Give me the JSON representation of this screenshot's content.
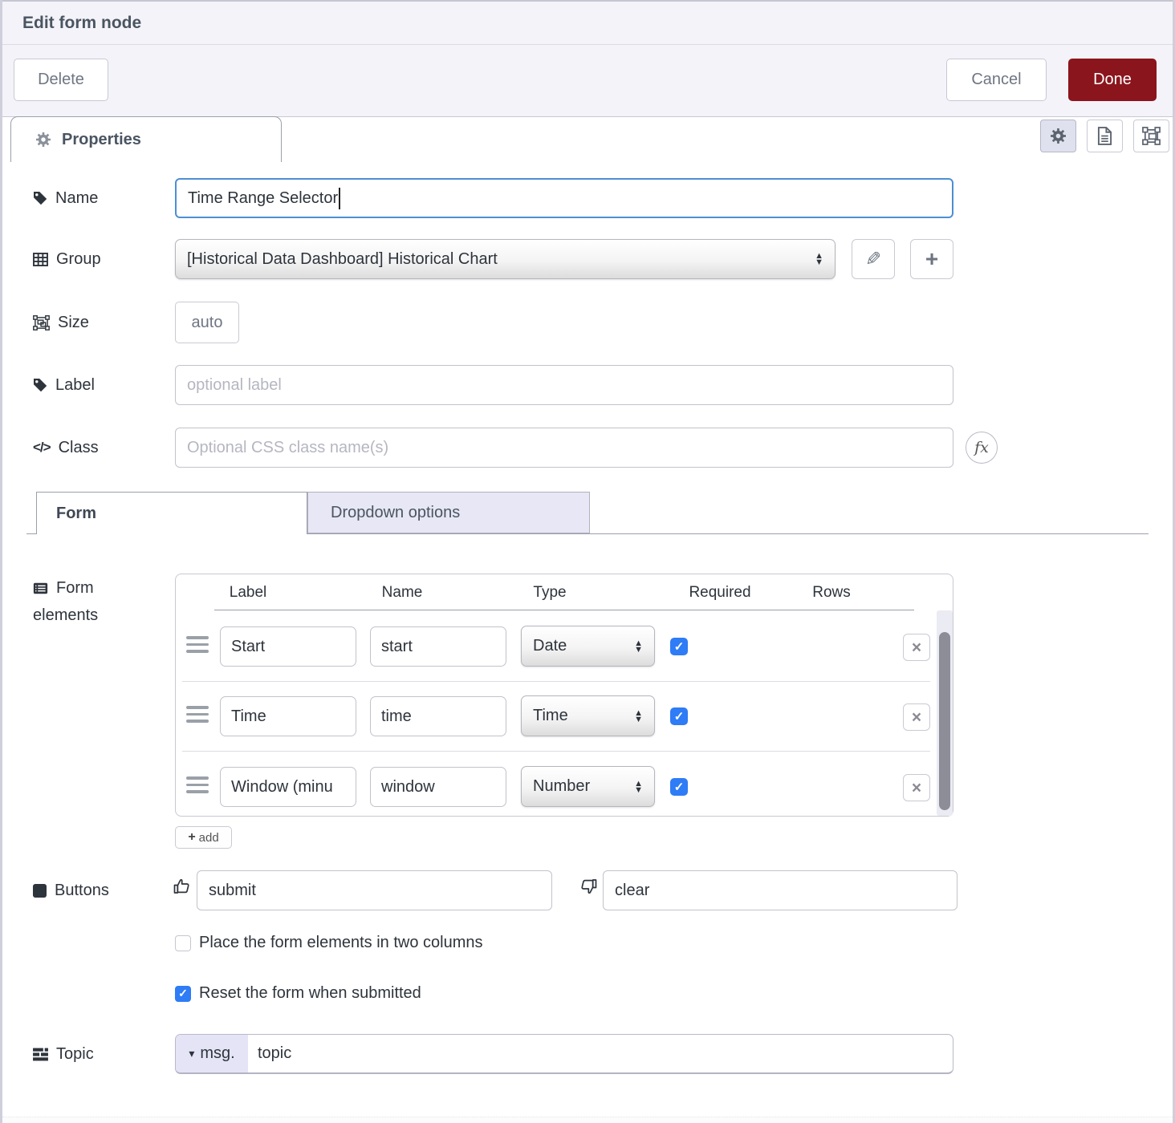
{
  "header": {
    "title": "Edit form node"
  },
  "toolbar": {
    "delete_label": "Delete",
    "cancel_label": "Cancel",
    "done_label": "Done"
  },
  "tabs": {
    "properties_label": "Properties"
  },
  "fields": {
    "name": {
      "label": "Name",
      "value": "Time Range Selector"
    },
    "group": {
      "label": "Group",
      "value": "[Historical Data Dashboard] Historical Chart"
    },
    "size": {
      "label": "Size",
      "value": "auto"
    },
    "label_field": {
      "label": "Label",
      "placeholder": "optional label"
    },
    "class_field": {
      "label": "Class",
      "placeholder": "Optional CSS class name(s)",
      "fx_label": "fx",
      "code_glyph": "</>"
    }
  },
  "subtabs": {
    "form_label": "Form",
    "dropdown_label": "Dropdown options"
  },
  "form_elements": {
    "label_line1": "Form",
    "label_line2": "elements",
    "columns": {
      "label": "Label",
      "name": "Name",
      "type": "Type",
      "required": "Required",
      "rows": "Rows"
    },
    "rows": [
      {
        "label": "Start",
        "name": "start",
        "type": "Date",
        "required": true,
        "rows": ""
      },
      {
        "label": "Time",
        "name": "time",
        "type": "Time",
        "required": true,
        "rows": ""
      },
      {
        "label": "Window (minu",
        "name": "window",
        "type": "Number",
        "required": true,
        "rows": ""
      }
    ],
    "add_label": "add"
  },
  "buttons_section": {
    "label": "Buttons",
    "submit_value": "submit",
    "clear_value": "clear"
  },
  "options": {
    "two_columns": {
      "label": "Place the form elements in two columns",
      "checked": false
    },
    "reset": {
      "label": "Reset the form when submitted",
      "checked": true
    }
  },
  "topic": {
    "label": "Topic",
    "prefix": "msg.",
    "value": "topic"
  },
  "icons": {
    "plus": "+",
    "close": "×",
    "check": "✓",
    "pencil": "✎",
    "arrow_up": "▲",
    "arrow_down": "▼",
    "caret_down": "▾"
  },
  "colors": {
    "accent_done": "#8b151d",
    "focus_blue": "#4d8fd2",
    "checkbox_blue": "#2e7cf6"
  }
}
